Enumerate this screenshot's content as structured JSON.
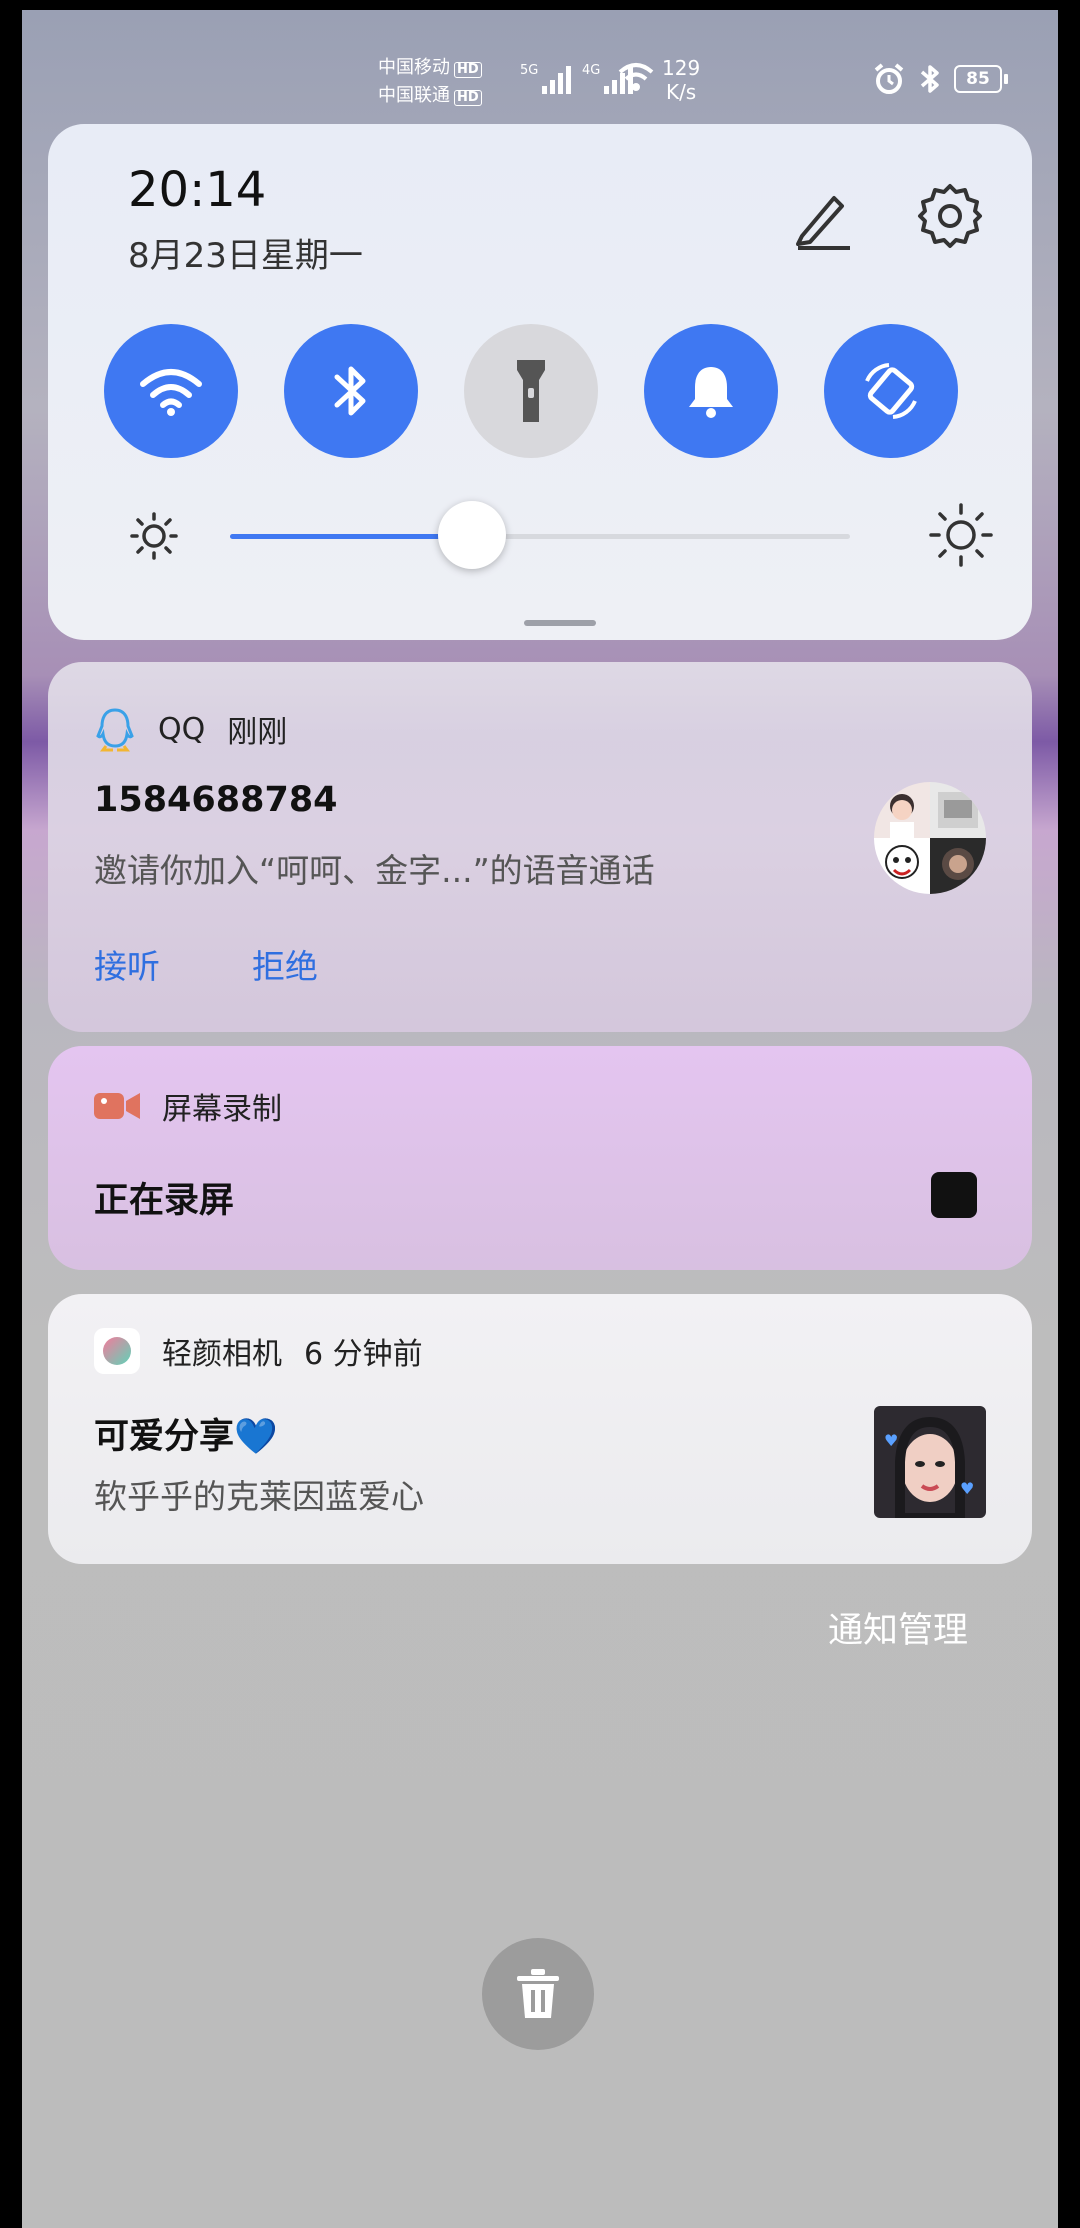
{
  "status_bar": {
    "carrier1": "中国移动",
    "carrier2": "中国联通",
    "hd": "HD",
    "net1": "5G",
    "net2": "4G",
    "speed_value": "129",
    "speed_unit": "K/s",
    "battery": "85"
  },
  "control_center": {
    "time": "20:14",
    "date": "8月23日星期一",
    "toggles": [
      {
        "name": "wifi",
        "on": true
      },
      {
        "name": "bluetooth",
        "on": true
      },
      {
        "name": "flashlight",
        "on": false
      },
      {
        "name": "sound",
        "on": true
      },
      {
        "name": "auto-rotate",
        "on": true
      }
    ],
    "brightness": 0.39
  },
  "notifications": {
    "qq": {
      "app": "QQ",
      "time": "刚刚",
      "title": "1584688784",
      "body": "邀请你加入“呵呵、金字...”的语音通话",
      "accept": "接听",
      "decline": "拒绝"
    },
    "screen_record": {
      "app": "屏幕录制",
      "title": "正在录屏"
    },
    "camera": {
      "app": "轻颜相机",
      "time": "6 分钟前",
      "title": "可爱分享💙",
      "body": "软乎乎的克莱因蓝爱心"
    }
  },
  "manage_label": "通知管理",
  "colors": {
    "accent": "#3f78f2",
    "link": "#2f6fe0",
    "record": "#e0735f"
  }
}
